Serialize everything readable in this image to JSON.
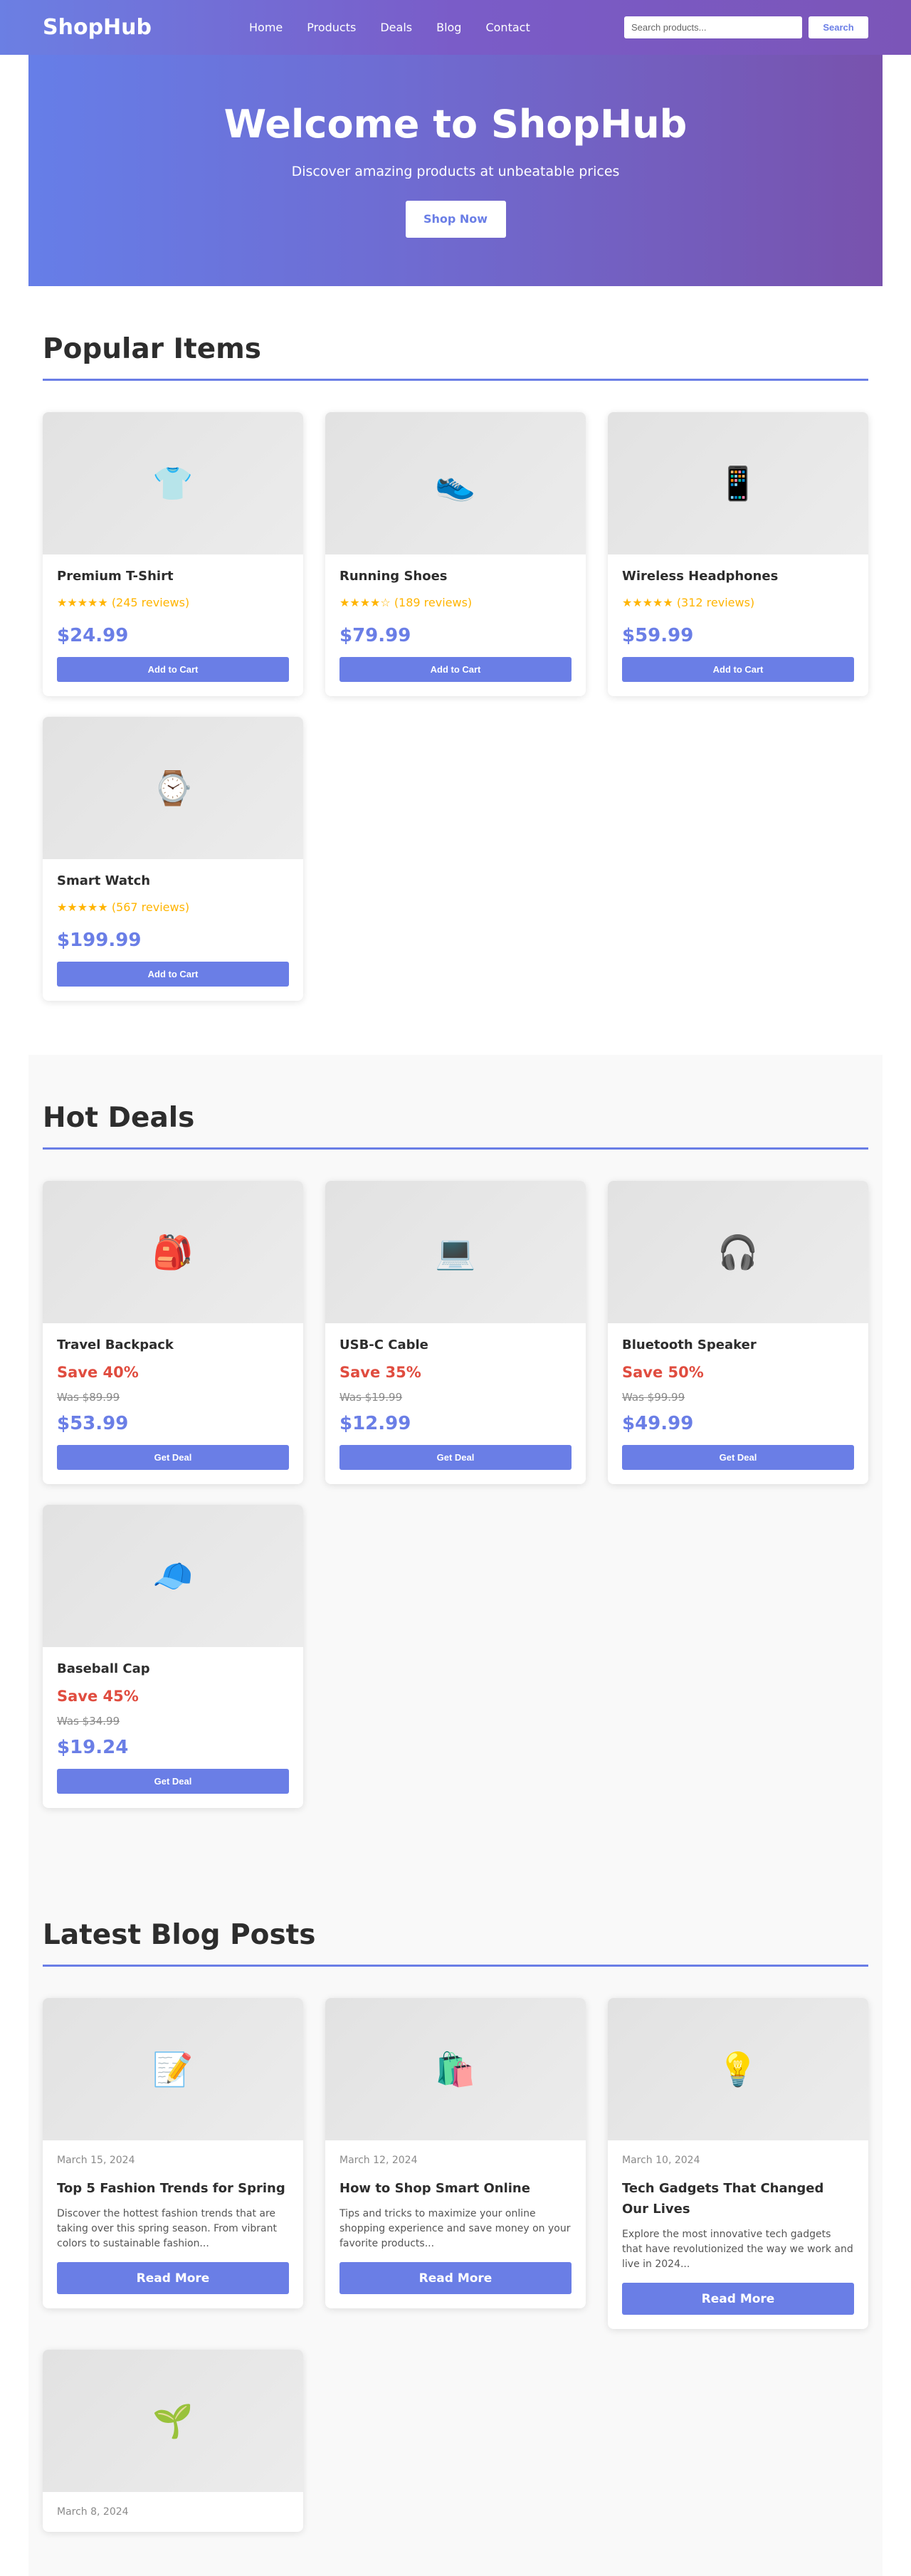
{
  "nav": {
    "logo": "ShopHub",
    "links": [
      "Home",
      "Products",
      "Deals",
      "Blog",
      "Contact"
    ],
    "search_placeholder": "Search products...",
    "search_button": "Search"
  },
  "hero": {
    "title": "Welcome to ShopHub",
    "subtitle": "Discover amazing products at unbeatable prices",
    "cta": "Shop Now"
  },
  "popular": {
    "title": "Popular Items",
    "button_label": "Add to Cart",
    "items": [
      {
        "emoji": "👕",
        "name": "Premium T-Shirt",
        "stars": "★★★★★",
        "reviews": "(245 reviews)",
        "rating": 5,
        "price": "$24.99"
      },
      {
        "emoji": "👟",
        "name": "Running Shoes",
        "stars": "★★★★☆",
        "reviews": "(189 reviews)",
        "rating": 4,
        "price": "$79.99"
      },
      {
        "emoji": "📱",
        "name": "Wireless Headphones",
        "stars": "★★★★★",
        "reviews": "(312 reviews)",
        "rating": 5,
        "price": "$59.99"
      },
      {
        "emoji": "⌚",
        "name": "Smart Watch",
        "stars": "★★★★★",
        "reviews": "(567 reviews)",
        "rating": 5,
        "price": "$199.99"
      }
    ]
  },
  "deals": {
    "title": "Hot Deals",
    "button_label": "Get Deal",
    "items": [
      {
        "emoji": "🎒",
        "name": "Travel Backpack",
        "save": "Save 40%",
        "was": "Was $89.99",
        "price": "$53.99"
      },
      {
        "emoji": "💻",
        "name": "USB-C Cable",
        "save": "Save 35%",
        "was": "Was $19.99",
        "price": "$12.99"
      },
      {
        "emoji": "🎧",
        "name": "Bluetooth Speaker",
        "save": "Save 50%",
        "was": "Was $99.99",
        "price": "$49.99"
      },
      {
        "emoji": "🧢",
        "name": "Baseball Cap",
        "save": "Save 45%",
        "was": "Was $34.99",
        "price": "$19.24"
      }
    ]
  },
  "blog": {
    "title": "Latest Blog Posts",
    "button_label": "Read More",
    "posts": [
      {
        "emoji": "📝",
        "date": "March 15, 2024",
        "title": "Top 5 Fashion Trends for Spring",
        "excerpt": "Discover the hottest fashion trends that are taking over this spring season. From vibrant colors to sustainable fashion..."
      },
      {
        "emoji": "🛍️",
        "date": "March 12, 2024",
        "title": "How to Shop Smart Online",
        "excerpt": "Tips and tricks to maximize your online shopping experience and save money on your favorite products..."
      },
      {
        "emoji": "💡",
        "date": "March 10, 2024",
        "title": "Tech Gadgets That Changed Our Lives",
        "excerpt": "Explore the most innovative tech gadgets that have revolutionized the way we work and live in 2024..."
      },
      {
        "emoji": "🌱",
        "date": "March 8, 2024"
      }
    ]
  },
  "colors": {
    "accent": "#6a7ee6",
    "deal_red": "#e04c3f",
    "star": "#ffb400"
  }
}
